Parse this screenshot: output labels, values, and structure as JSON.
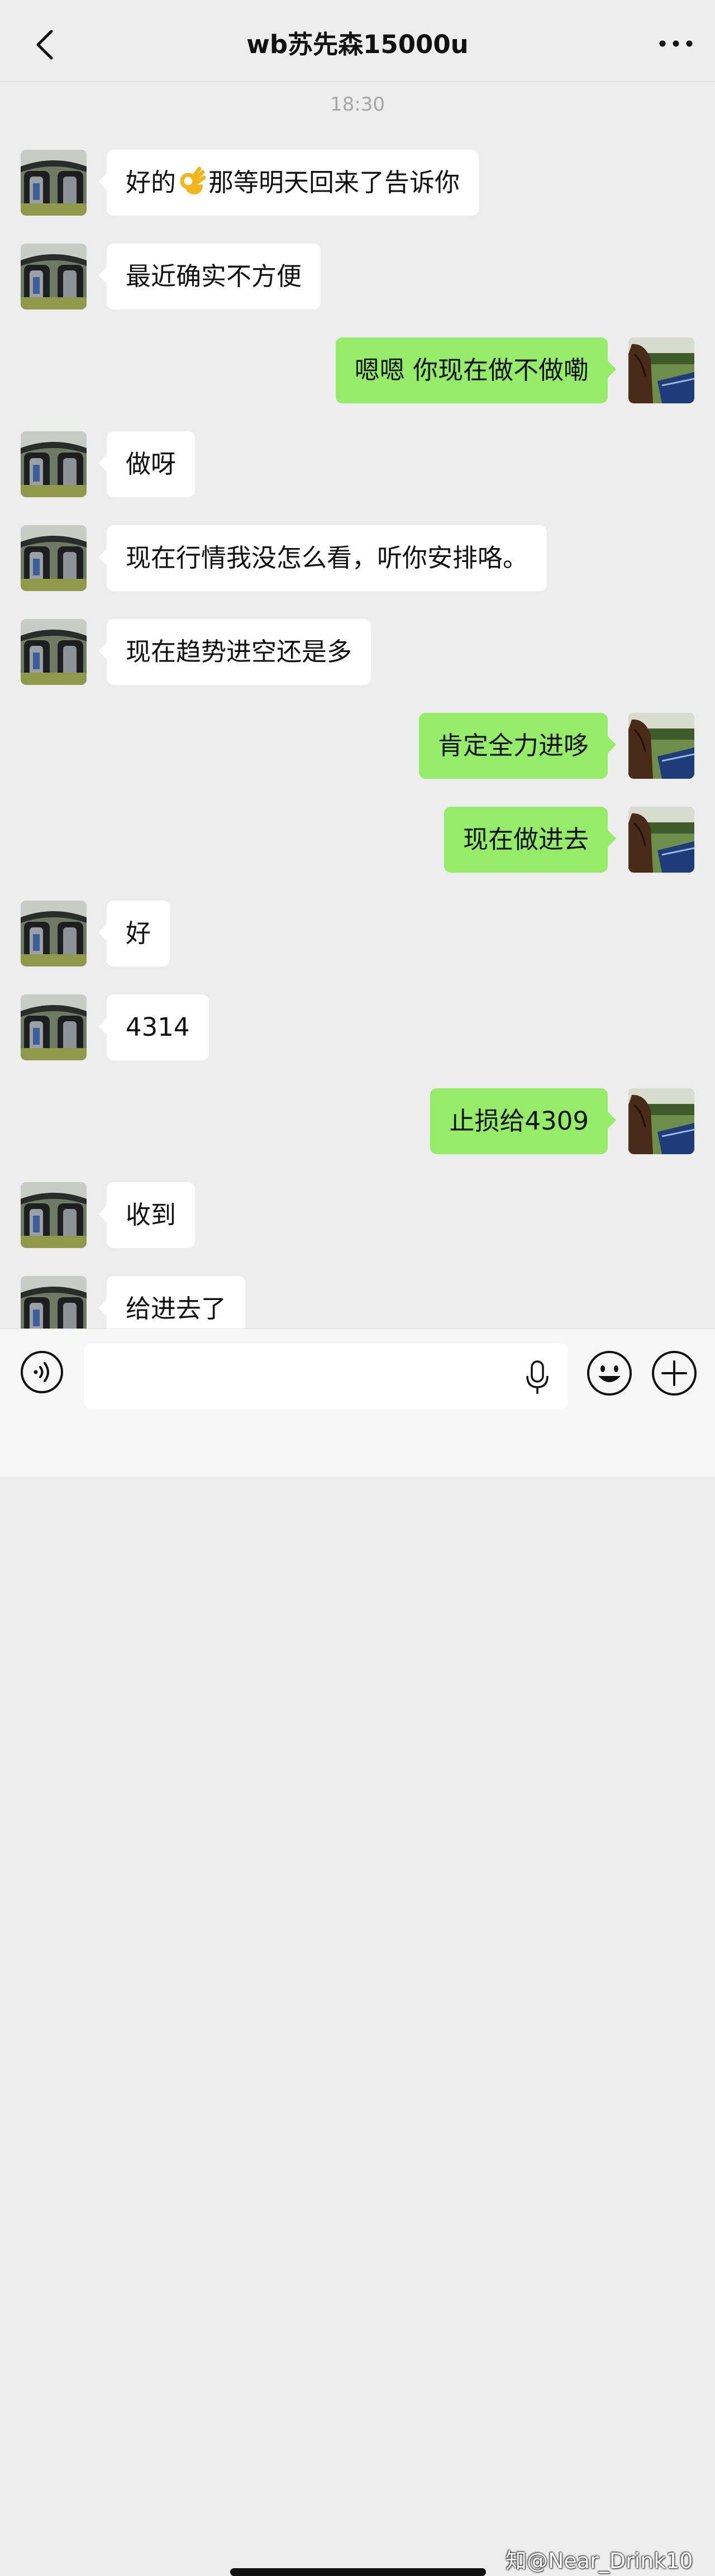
{
  "header": {
    "title": "wb苏先森15000u"
  },
  "timestamp": "18:30",
  "messages": [
    {
      "side": "in",
      "pre": "好的",
      "emoji": "ok-hand",
      "post": "那等明天回来了告诉你"
    },
    {
      "side": "in",
      "text": "最近确实不方便"
    },
    {
      "side": "out",
      "text": "嗯嗯 你现在做不做嘞"
    },
    {
      "side": "in",
      "text": "做呀"
    },
    {
      "side": "in",
      "text": "现在行情我没怎么看，听你安排咯。"
    },
    {
      "side": "in",
      "text": "现在趋势进空还是多"
    },
    {
      "side": "out",
      "text": "肯定全力进哆"
    },
    {
      "side": "out",
      "text": "现在做进去"
    },
    {
      "side": "in",
      "text": "好"
    },
    {
      "side": "in",
      "text": "4314"
    },
    {
      "side": "out",
      "text": "止损给4309"
    },
    {
      "side": "in",
      "text": "收到"
    },
    {
      "side": "in",
      "text": "给进去了"
    }
  ],
  "input": {
    "value": "",
    "placeholder": ""
  },
  "icons": {
    "back": "chevron-left-icon",
    "more": "more-dots-icon",
    "voice": "voice-icon",
    "mic": "mic-icon",
    "emoji": "emoji-icon",
    "plus": "plus-icon"
  },
  "colors": {
    "outgoing_bubble": "#95ec69",
    "incoming_bubble": "#ffffff",
    "background": "#ededed"
  },
  "watermark": "知@Near_Drink10"
}
